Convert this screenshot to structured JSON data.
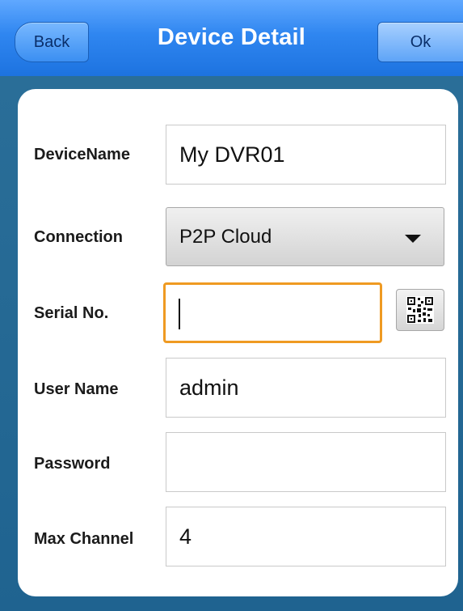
{
  "titlebar": {
    "title": "Device Detail",
    "back_label": "Back",
    "ok_label": "Ok"
  },
  "form": {
    "device_name": {
      "label": "DeviceName",
      "value": "My DVR01"
    },
    "connection": {
      "label": "Connection",
      "value": "P2P Cloud"
    },
    "serial_no": {
      "label": "Serial No.",
      "value": ""
    },
    "user_name": {
      "label": "User Name",
      "value": "admin"
    },
    "password": {
      "label": "Password",
      "value": ""
    },
    "max_channel": {
      "label": "Max Channel",
      "value": "4"
    }
  },
  "colors": {
    "titlebar_blue": "#2f86f0",
    "panel_blue": "#246894",
    "focus_orange": "#ef9a22"
  },
  "icons": {
    "dropdown": "caret-down-icon",
    "scan": "qr-code-icon"
  }
}
